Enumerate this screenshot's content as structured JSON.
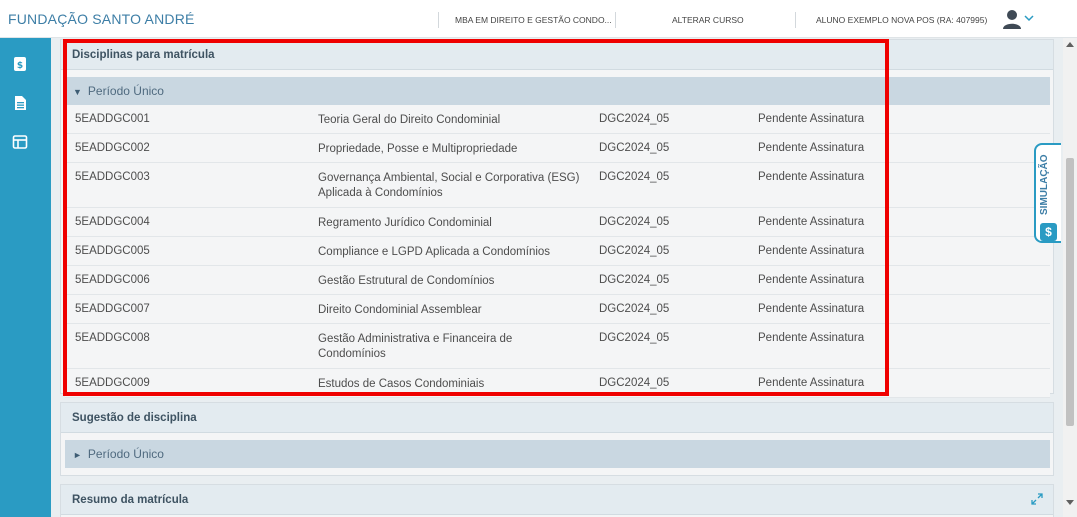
{
  "header": {
    "brand": "FUNDAÇÃO SANTO ANDRÉ",
    "course": "MBA EM DIREITO E GESTÃO CONDO...",
    "change_course": "ALTERAR CURSO",
    "student": "ALUNO EXEMPLO NOVA POS (RA: 407995)",
    "user_icon": "user-icon",
    "menu_icon": "chevron-down-icon"
  },
  "sidebar": {
    "items": [
      {
        "icon": "dollar-document-icon"
      },
      {
        "icon": "document-icon"
      },
      {
        "icon": "layout-icon"
      }
    ]
  },
  "enrollment_panel": {
    "title": "Disciplinas para matrícula",
    "group": "Período Único",
    "rows": [
      {
        "code": "5EADDGC001",
        "name": "Teoria Geral do Direito Condominial",
        "class": "DGC2024_05",
        "status": "Pendente Assinatura"
      },
      {
        "code": "5EADDGC002",
        "name": "Propriedade, Posse e Multipropriedade",
        "class": "DGC2024_05",
        "status": "Pendente Assinatura"
      },
      {
        "code": "5EADDGC003",
        "name": "Governança Ambiental, Social e Corporativa (ESG) Aplicada à Condomínios",
        "class": "DGC2024_05",
        "status": "Pendente Assinatura"
      },
      {
        "code": "5EADDGC004",
        "name": "Regramento Jurídico Condominial",
        "class": "DGC2024_05",
        "status": "Pendente Assinatura"
      },
      {
        "code": "5EADDGC005",
        "name": "Compliance e LGPD Aplicada a Condomínios",
        "class": "DGC2024_05",
        "status": "Pendente Assinatura"
      },
      {
        "code": "5EADDGC006",
        "name": "Gestão Estrutural de Condomínios",
        "class": "DGC2024_05",
        "status": "Pendente Assinatura"
      },
      {
        "code": "5EADDGC007",
        "name": "Direito Condominial Assemblear",
        "class": "DGC2024_05",
        "status": "Pendente Assinatura"
      },
      {
        "code": "5EADDGC008",
        "name": "Gestão Administrativa e Financeira de Condomínios",
        "class": "DGC2024_05",
        "status": "Pendente Assinatura"
      },
      {
        "code": "5EADDGC009",
        "name": "Estudos de Casos Condominiais",
        "class": "DGC2024_05",
        "status": "Pendente Assinatura"
      }
    ]
  },
  "suggestion_panel": {
    "title": "Sugestão de disciplina",
    "group": "Período Único"
  },
  "summary_panel": {
    "title": "Resumo da matrícula",
    "expand_icon": "expand-icon"
  },
  "simulation_tab": {
    "label": "SIMULAÇÃO",
    "icon_text": "$"
  },
  "colors": {
    "accent": "#2a9bc3",
    "highlight": "#ef0000",
    "group_header": "#c9d7e1"
  }
}
